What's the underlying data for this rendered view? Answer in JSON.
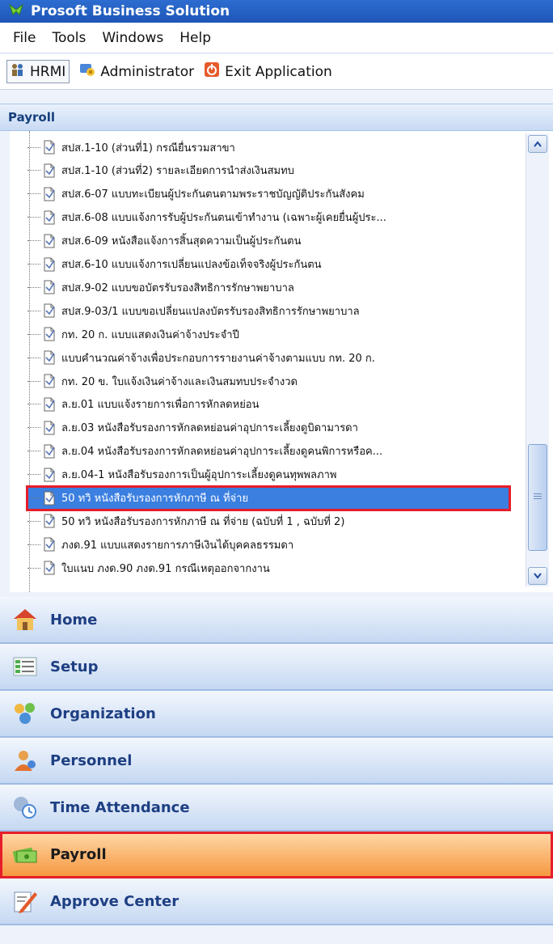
{
  "window": {
    "title": "Prosoft Business Solution"
  },
  "menu": [
    "File",
    "Tools",
    "Windows",
    "Help"
  ],
  "toolbar": {
    "hrmi_label": "HRMI",
    "admin_label": "Administrator",
    "exit_label": "Exit Application"
  },
  "section": {
    "title": "Payroll"
  },
  "tree": {
    "items": [
      "สปส.1-10 (ส่วนที่1) กรณียื่นรวมสาขา",
      "สปส.1-10 (ส่วนที่2) รายละเอียดการนำส่งเงินสมทบ",
      "สปส.6-07 แบบทะเบียนผู้ประกันตนตามพระราชบัญญัติประกันสังคม",
      "สปส.6-08 แบบแจ้งการรับผู้ประกันตนเข้าทำงาน (เฉพาะผู้เคยยื่นผู้ประ...",
      "สปส.6-09 หนังสือแจ้งการสิ้นสุดความเป็นผู้ประกันตน",
      "สปส.6-10 แบบแจ้งการเปลี่ยนแปลงข้อเท็จจริงผู้ประกันตน",
      "สปส.9-02 แบบขอบัตรรับรองสิทธิการรักษาพยาบาล",
      "สปส.9-03/1 แบบขอเปลี่ยนแปลงบัตรรับรองสิทธิการรักษาพยาบาล",
      "กท. 20 ก. แบบแสดงเงินค่าจ้างประจำปี",
      "แบบคำนวณค่าจ้างเพื่อประกอบการรายงานค่าจ้างตามแบบ กท. 20 ก.",
      "กท. 20 ข. ใบแจ้งเงินค่าจ้างและเงินสมทบประจำงวด",
      "ล.ย.01 แบบแจ้งรายการเพื่อการหักลดหย่อน",
      "ล.ย.03 หนังสือรับรองการหักลดหย่อนค่าอุปการะเลี้ยงดูบิดามารดา",
      "ล.ย.04 หนังสือรับรองการหักลดหย่อนค่าอุปการะเลี้ยงดูคนพิการหรือค...",
      "ล.ย.04-1 หนังสือรับรองการเป็นผู้อุปการะเลี้ยงดูคนทุพพลภาพ",
      "50 ทวิ หนังสือรับรองการหักภาษี ณ ที่จ่าย",
      "50 ทวิ หนังสือรับรองการหักภาษี ณ ที่จ่าย (ฉบับที่ 1 , ฉบับที่ 2)",
      "ภงด.91 แบบแสดงรายการภาษีเงินได้บุคคลธรรมดา",
      "ใบแนบ ภงด.90 ภงด.91 กรณีเหตุออกจากงาน"
    ],
    "selected_index": 15
  },
  "nav": {
    "home": "Home",
    "setup": "Setup",
    "organization": "Organization",
    "personnel": "Personnel",
    "time_attendance": "Time Attendance",
    "payroll": "Payroll",
    "approve_center": "Approve Center"
  },
  "colors": {
    "selection": "#3b7fe0",
    "highlight": "#e51e2a",
    "active_nav": "#f5973f"
  },
  "icons": [
    "app-logo-icon",
    "hrmi-icon",
    "administrator-icon",
    "exit-icon",
    "document-icon",
    "home-icon",
    "setup-icon",
    "organization-icon",
    "personnel-icon",
    "time-attendance-icon",
    "payroll-icon",
    "approve-center-icon"
  ]
}
